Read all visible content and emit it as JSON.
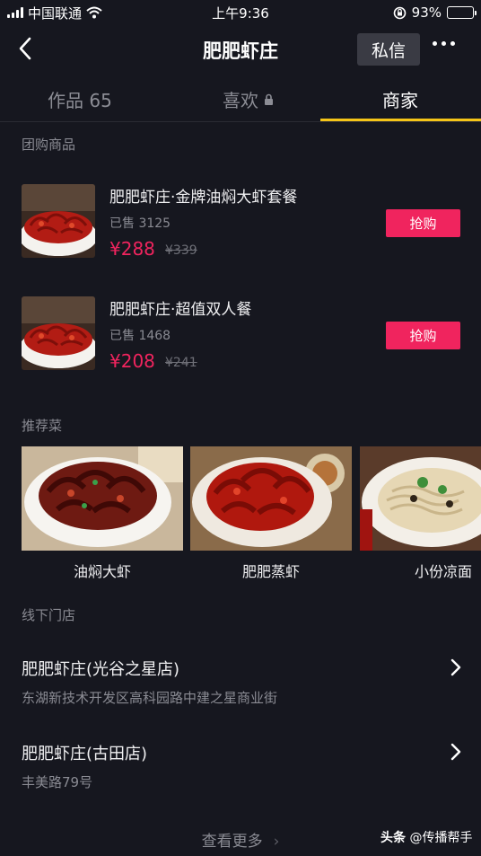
{
  "status_bar": {
    "carrier": "中国联通",
    "time": "上午9:36",
    "battery": "93%",
    "battery_level": 0.93
  },
  "header": {
    "title": "肥肥虾庄",
    "message_button": "私信"
  },
  "tabs": [
    {
      "label": "作品 65",
      "active": false
    },
    {
      "label": "喜欢",
      "active": false,
      "icon": "lock-icon"
    },
    {
      "label": "商家",
      "active": true
    }
  ],
  "group_buy": {
    "section_title": "团购商品",
    "products": [
      {
        "name": "肥肥虾庄·金牌油焖大虾套餐",
        "sold": "已售 3125",
        "price": "¥288",
        "original_price": "¥339",
        "button": "抢购"
      },
      {
        "name": "肥肥虾庄·超值双人餐",
        "sold": "已售 1468",
        "price": "¥208",
        "original_price": "¥241",
        "button": "抢购"
      }
    ]
  },
  "recommended": {
    "section_title": "推荐菜",
    "dishes": [
      {
        "name": "油焖大虾"
      },
      {
        "name": "肥肥蒸虾"
      },
      {
        "name": "小份凉面"
      }
    ]
  },
  "stores": {
    "section_title": "线下门店",
    "items": [
      {
        "name": "肥肥虾庄(光谷之星店)",
        "address": "东湖新技术开发区高科园路中建之星商业街"
      },
      {
        "name": "肥肥虾庄(古田店)",
        "address": "丰美路79号"
      }
    ]
  },
  "footer": {
    "see_more": "查看更多",
    "watermark_brand": "头条",
    "watermark_handle": "@传播帮手"
  },
  "colors": {
    "background": "#16171f",
    "accent_red": "#f0245e",
    "tab_underline": "#f5c518"
  }
}
